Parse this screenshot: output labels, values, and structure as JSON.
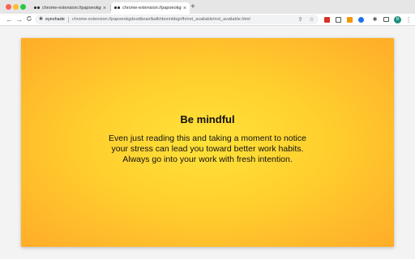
{
  "browser": {
    "tabs": [
      {
        "title": "chrome-extension://papoeokgdoodkeanila",
        "close": "×"
      },
      {
        "title": "chrome-extension://papoeokgdoodkeanila",
        "close": "×"
      }
    ],
    "new_tab": "+",
    "nav": {
      "back": "←",
      "forward": "→",
      "reload": "C"
    },
    "omnibox": {
      "origin": "eyeshade",
      "url": "chrome-extension://papoeokgdoodkeanlladkhbonnbbgnfh/not_available/not_available.html"
    },
    "toolbar_icons": {
      "share": "⇪",
      "star": "☆",
      "puzzle": "✱",
      "menu": "⋮"
    },
    "avatar_letter": "R",
    "colors": {
      "card_center": "#ffe23a",
      "card_edge": "#ffad28",
      "avatar": "#1e8e7e"
    }
  },
  "page": {
    "title": "Be mindful",
    "message": "Even just reading this and taking a moment to notice your stress can lead you toward better work habits. Always go into your work with fresh intention."
  }
}
